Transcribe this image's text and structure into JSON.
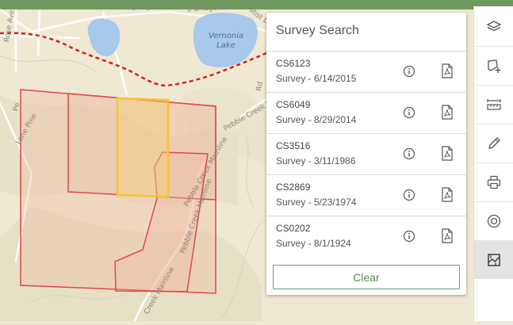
{
  "map": {
    "street_labels": [
      {
        "text": "Rose Ave",
        "name": "street-rose-ave"
      },
      {
        "text": "Bridge St",
        "name": "street-bridge-st"
      },
      {
        "text": "E Bridge St",
        "name": "street-e-bridge-st"
      },
      {
        "text": "Mist Dr",
        "name": "street-mist-dr"
      },
      {
        "text": "Pebble Creek Rd",
        "name": "street-pebble-creek-rd"
      },
      {
        "text": "Pebble Creek Mainline",
        "name": "street-pebble-creek-mainline"
      },
      {
        "text": "Pebble Creek Mainline",
        "name": "street-pebble-creek-mainline-2"
      },
      {
        "text": "Creek Mainline",
        "name": "street-creek-mainline"
      },
      {
        "text": "Lone Pine",
        "name": "street-lone-pine"
      },
      {
        "text": "Rd",
        "name": "street-rd"
      },
      {
        "text": "Pe",
        "name": "street-pe"
      }
    ],
    "lake_label": "Vernonia\nLake",
    "colors": {
      "parcel_outline": "#e04848",
      "parcel_fill": "#f0b8a0",
      "selected_outline": "#f5c530",
      "boundary_line": "#d62020"
    }
  },
  "panel": {
    "title": "Survey Search",
    "surveys": [
      {
        "id": "CS6123",
        "date": "Survey - 6/14/2015"
      },
      {
        "id": "CS6049",
        "date": "Survey - 8/29/2014"
      },
      {
        "id": "CS3516",
        "date": "Survey - 3/11/1986"
      },
      {
        "id": "CS2869",
        "date": "Survey - 5/23/1974"
      },
      {
        "id": "CS0202",
        "date": "Survey - 8/1/1924"
      }
    ],
    "clear_label": "Clear"
  },
  "toolbar": {
    "tools": [
      {
        "icon": "layers-icon"
      },
      {
        "icon": "add-area-icon"
      },
      {
        "icon": "measure-icon"
      },
      {
        "icon": "draw-icon"
      },
      {
        "icon": "print-icon"
      },
      {
        "icon": "locate-icon"
      },
      {
        "icon": "survey-icon",
        "active": true
      }
    ]
  }
}
